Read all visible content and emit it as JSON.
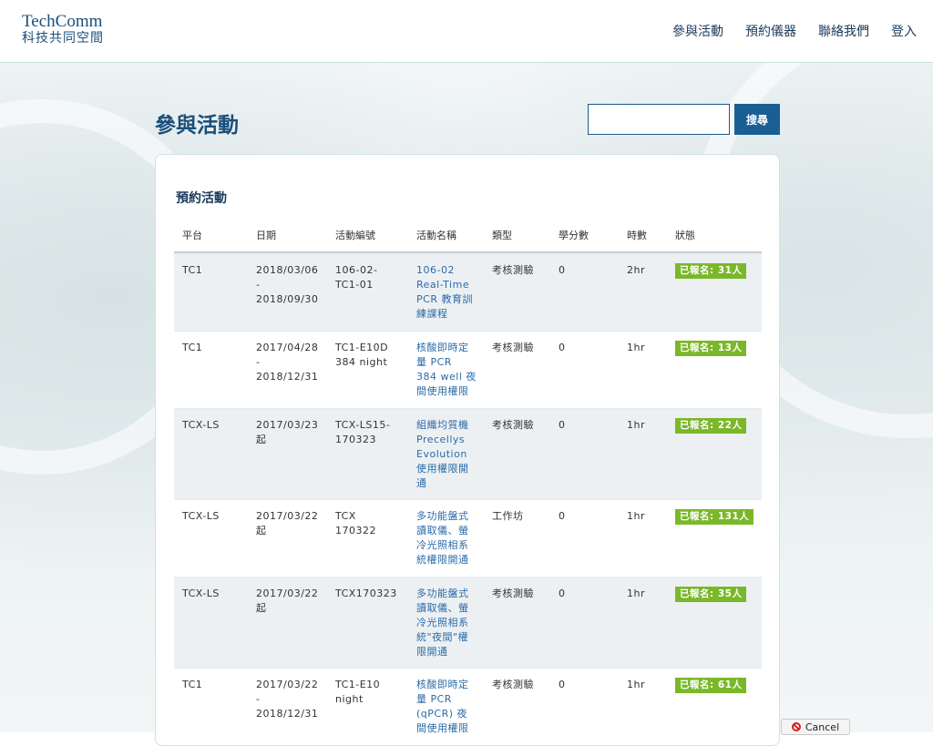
{
  "header": {
    "logo_en": "TechComm",
    "logo_zh": "科技共同空間",
    "nav": [
      "參與活動",
      "預約儀器",
      "聯絡我們",
      "登入"
    ]
  },
  "page_title": "參與活動",
  "search": {
    "button_label": "搜尋",
    "value": ""
  },
  "section_title": "預約活動",
  "table": {
    "headers": [
      "平台",
      "日期",
      "活動編號",
      "活動名稱",
      "類型",
      "學分數",
      "時數",
      "狀態"
    ],
    "rows": [
      {
        "platform": "TC1",
        "date": "2018/03/06\n-\n2018/09/30",
        "no": "106-02-\nTC1-01",
        "name": "106-02\nReal-Time\nPCR 教育訓\n練課程",
        "type": "考核測驗",
        "credits": "0",
        "hours": "2hr",
        "status": "已報名: 31人"
      },
      {
        "platform": "TC1",
        "date": "2017/04/28\n-\n2018/12/31",
        "no": "TC1-E10D\n384 night",
        "name": "核酸即時定\n量 PCR\n384 well 夜\n間使用權限",
        "type": "考核測驗",
        "credits": "0",
        "hours": "1hr",
        "status": "已報名: 13人"
      },
      {
        "platform": "TCX-LS",
        "date": "2017/03/23\n起",
        "no": "TCX-LS15-\n170323",
        "name": "組織均質機\nPrecellys\nEvolution\n使用權限開\n通",
        "type": "考核測驗",
        "credits": "0",
        "hours": "1hr",
        "status": "已報名: 22人"
      },
      {
        "platform": "TCX-LS",
        "date": "2017/03/22\n起",
        "no": "TCX\n170322",
        "name": "多功能盤式\n讀取儀、螢\n冷光照相系\n統權限開通",
        "type": "工作坊",
        "credits": "0",
        "hours": "1hr",
        "status": "已報名: 131人"
      },
      {
        "platform": "TCX-LS",
        "date": "2017/03/22\n起",
        "no": "TCX170323",
        "name": "多功能盤式\n讀取儀、螢\n冷光照相系\n統\"夜間\"權\n限開通",
        "type": "考核測驗",
        "credits": "0",
        "hours": "1hr",
        "status": "已報名: 35人"
      },
      {
        "platform": "TC1",
        "date": "2017/03/22\n-\n2018/12/31",
        "no": "TC1-E10\nnight",
        "name": "核酸即時定\n量 PCR\n(qPCR) 夜\n間使用權限",
        "type": "考核測驗",
        "credits": "0",
        "hours": "1hr",
        "status": "已報名: 61人"
      }
    ]
  },
  "cancel_label": "Cancel",
  "colors": {
    "brand": "#1a4f7a",
    "badge": "#7ab82a",
    "link": "#2a6ba8"
  }
}
